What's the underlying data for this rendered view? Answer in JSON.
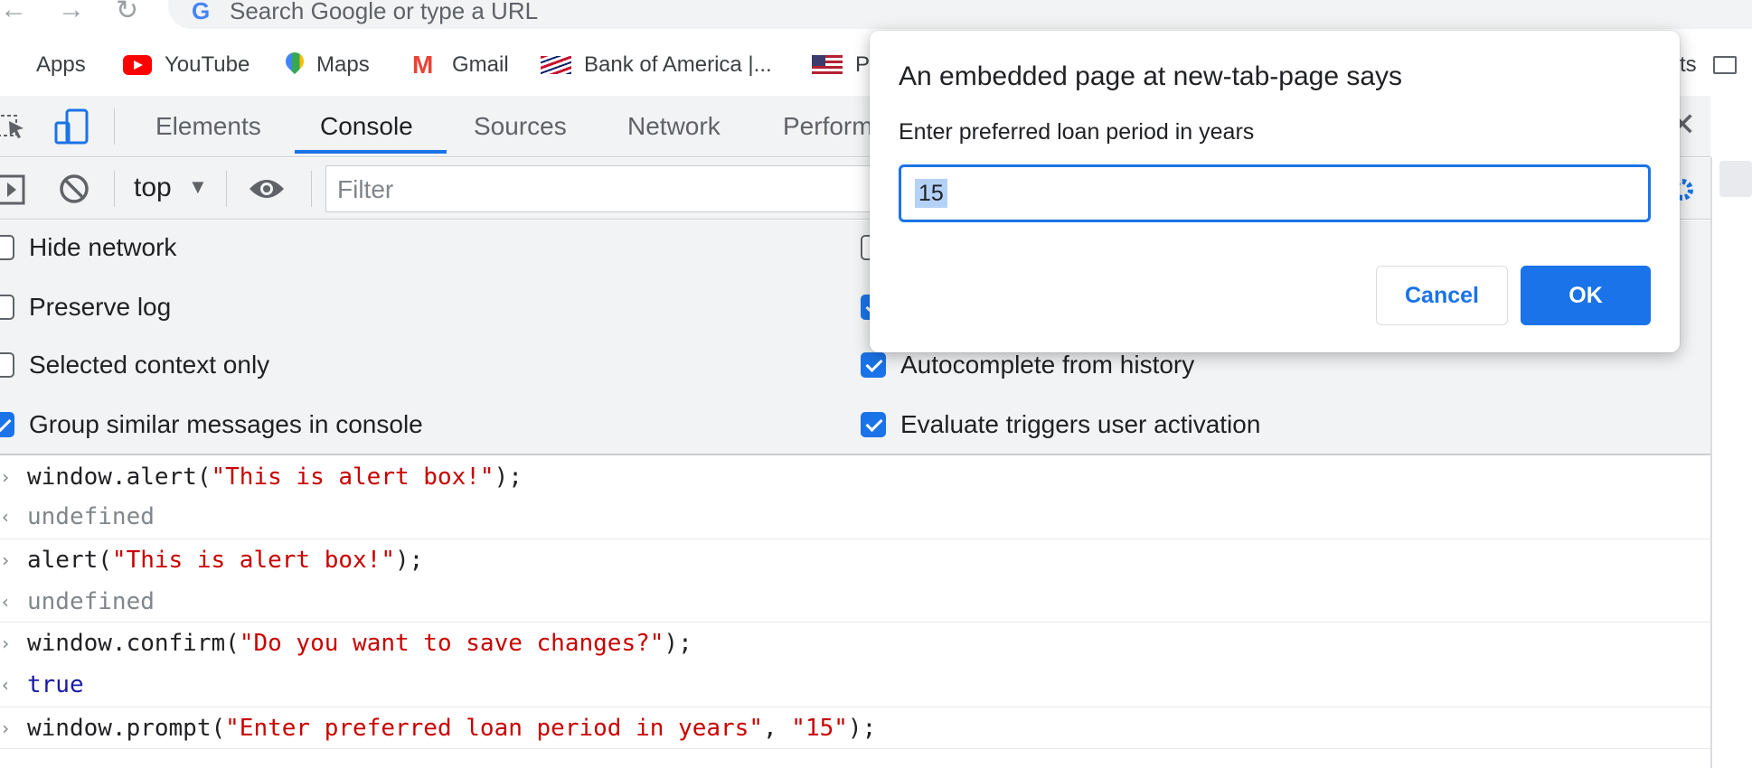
{
  "browser": {
    "omnibox_placeholder": "Search Google or type a URL"
  },
  "bookmarks": [
    {
      "label": "Apps",
      "icon": "apps-grid-icon"
    },
    {
      "label": "YouTube",
      "icon": "youtube-icon"
    },
    {
      "label": "Maps",
      "icon": "maps-pin-icon"
    },
    {
      "label": "Gmail",
      "icon": "gmail-icon"
    },
    {
      "label": "Bank of America |...",
      "icon": "bank-of-america-icon"
    },
    {
      "label": "P",
      "icon": "us-flag-icon"
    },
    {
      "label": "cts",
      "icon": "folder-icon"
    }
  ],
  "devtools": {
    "tabs": [
      "Elements",
      "Console",
      "Sources",
      "Network",
      "Perform"
    ],
    "active_tab": "Console",
    "context_selector": "top",
    "filter_placeholder": "Filter",
    "settings_left": [
      {
        "label": "Hide network",
        "checked": false
      },
      {
        "label": "Preserve log",
        "checked": false
      },
      {
        "label": "Selected context only",
        "checked": false
      },
      {
        "label": "Group similar messages in console",
        "checked": true
      }
    ],
    "settings_right": [
      {
        "label": "",
        "checked": false
      },
      {
        "label": "",
        "checked": true
      },
      {
        "label": "Autocomplete from history",
        "checked": true
      },
      {
        "label": "Evaluate triggers user activation",
        "checked": true
      }
    ],
    "console": [
      {
        "type": "input",
        "fn": "window.alert(",
        "arg": "\"This is alert box!\"",
        "tail": ");"
      },
      {
        "type": "result",
        "text": "undefined"
      },
      {
        "type": "input",
        "fn": "alert(",
        "arg": "\"This is alert box!\"",
        "tail": ");"
      },
      {
        "type": "result",
        "text": "undefined"
      },
      {
        "type": "input",
        "fn": "window.confirm(",
        "arg": "\"Do you want to save changes?\"",
        "tail": ");"
      },
      {
        "type": "result-bool",
        "text": "true"
      },
      {
        "type": "input",
        "fn": "window.prompt(",
        "arg": "\"Enter preferred loan period in years\"",
        "sep": ", ",
        "arg2": "\"15\"",
        "tail": ");"
      }
    ]
  },
  "dialog": {
    "title": "An embedded page at new-tab-page says",
    "message": "Enter preferred loan period in years",
    "input_value": "15",
    "cancel_label": "Cancel",
    "ok_label": "OK"
  },
  "colors": {
    "accent": "#1a73e8",
    "string": "#c80000",
    "keyword": "#1a1aa6"
  }
}
